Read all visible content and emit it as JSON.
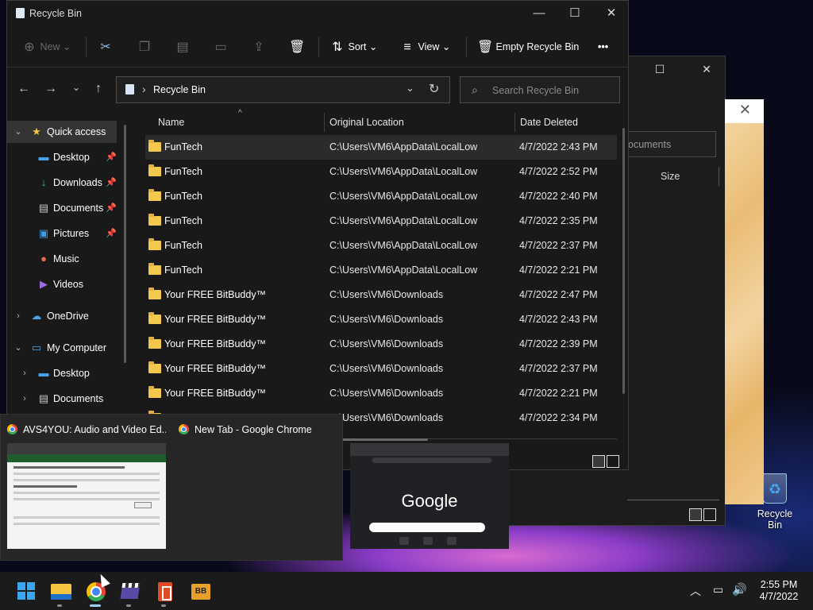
{
  "explorer": {
    "title": "Recycle Bin",
    "toolbar": {
      "new_label": "New",
      "sort_label": "Sort",
      "view_label": "View",
      "empty_label": "Empty Recycle Bin",
      "more_label": "•••"
    },
    "address": {
      "path": "Recycle Bin"
    },
    "search": {
      "placeholder": "Search Recycle Bin"
    },
    "nav": {
      "quick_access": "Quick access",
      "items": [
        {
          "label": "Desktop",
          "pinned": true,
          "icon": "desktop-icon"
        },
        {
          "label": "Downloads",
          "pinned": true,
          "icon": "downloads-icon"
        },
        {
          "label": "Documents",
          "pinned": true,
          "icon": "documents-icon"
        },
        {
          "label": "Pictures",
          "pinned": true,
          "icon": "pictures-icon"
        },
        {
          "label": "Music",
          "pinned": false,
          "icon": "music-icon"
        },
        {
          "label": "Videos",
          "pinned": false,
          "icon": "videos-icon"
        }
      ],
      "onedrive": "OneDrive",
      "my_computer": "My Computer",
      "computer_items": [
        "Desktop",
        "Documents"
      ]
    },
    "columns": [
      "Name",
      "Original Location",
      "Date Deleted"
    ],
    "rows": [
      {
        "name": "FunTech",
        "location": "C:\\Users\\VM6\\AppData\\LocalLow",
        "date": "4/7/2022 2:43 PM"
      },
      {
        "name": "FunTech",
        "location": "C:\\Users\\VM6\\AppData\\LocalLow",
        "date": "4/7/2022 2:52 PM"
      },
      {
        "name": "FunTech",
        "location": "C:\\Users\\VM6\\AppData\\LocalLow",
        "date": "4/7/2022 2:40 PM"
      },
      {
        "name": "FunTech",
        "location": "C:\\Users\\VM6\\AppData\\LocalLow",
        "date": "4/7/2022 2:35 PM"
      },
      {
        "name": "FunTech",
        "location": "C:\\Users\\VM6\\AppData\\LocalLow",
        "date": "4/7/2022 2:37 PM"
      },
      {
        "name": "FunTech",
        "location": "C:\\Users\\VM6\\AppData\\LocalLow",
        "date": "4/7/2022 2:21 PM"
      },
      {
        "name": "Your FREE BitBuddy™",
        "location": "C:\\Users\\VM6\\Downloads",
        "date": "4/7/2022 2:47 PM"
      },
      {
        "name": "Your FREE BitBuddy™",
        "location": "C:\\Users\\VM6\\Downloads",
        "date": "4/7/2022 2:43 PM"
      },
      {
        "name": "Your FREE BitBuddy™",
        "location": "C:\\Users\\VM6\\Downloads",
        "date": "4/7/2022 2:39 PM"
      },
      {
        "name": "Your FREE BitBuddy™",
        "location": "C:\\Users\\VM6\\Downloads",
        "date": "4/7/2022 2:37 PM"
      },
      {
        "name": "Your FREE BitBuddy™",
        "location": "C:\\Users\\VM6\\Downloads",
        "date": "4/7/2022 2:21 PM"
      },
      {
        "name": "",
        "location": "C:\\Users\\VM6\\Downloads",
        "date": "4/7/2022 2:34 PM"
      }
    ]
  },
  "background_window": {
    "search_text": "ocuments",
    "column_label": "Size"
  },
  "desktop": {
    "recycle_bin_label": "Recycle Bin"
  },
  "thumbnails": [
    {
      "title": "AVS4YOU: Audio and Video Ed..."
    },
    {
      "title": "New Tab - Google Chrome",
      "preview_logo": "Google"
    }
  ],
  "clock": {
    "time": "2:55 PM",
    "date": "4/7/2022"
  },
  "colors": {
    "accent": "#3aa7f0",
    "folder": "#f2c94c"
  }
}
